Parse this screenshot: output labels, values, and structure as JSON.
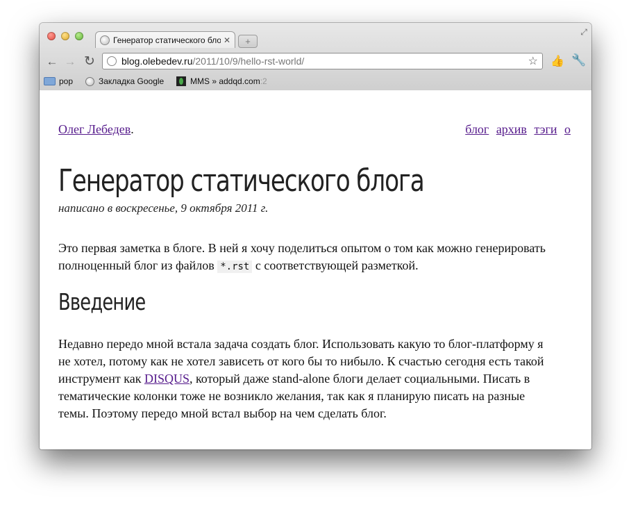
{
  "browser": {
    "tab_title": "Генератор статического бло",
    "tab_close": "✕",
    "new_tab": "+",
    "url_host": "blog.olebedev.ru",
    "url_path": "/2011/10/9/hello-rst-world/",
    "bookmarks": [
      {
        "label": "pop",
        "icon": "folder-icon"
      },
      {
        "label": "Закладка Google",
        "icon": "globe-icon"
      },
      {
        "label": "MMS » addqd.com",
        "suffix": ":2",
        "icon": "mms-icon"
      }
    ]
  },
  "site": {
    "author_link": "Олег Лебедев",
    "author_suffix": ".",
    "nav": [
      "блог",
      "архив",
      "тэги",
      "о"
    ]
  },
  "post": {
    "title": "Генератор статического блога",
    "date": "написано в воскресенье, 9 октября 2011 г.",
    "intro_before": "Это первая заметка в блоге. В ней я хочу поделиться опытом о том как можно генерировать полноценный блог из файлов ",
    "intro_code": "*.rst",
    "intro_after": " с соответствующей разметкой.",
    "section_title": "Введение",
    "body_before": "Недавно передо мной встала задача создать блог. Использовать какую то блог-платформу я не хотел, потому как не хотел зависеть от кого бы то нибыло. К счастью сегодня есть такой инструмент как ",
    "body_link": "DISQUS",
    "body_after": ", который даже stand-alone блоги делает социальными. Писать в тематические колонки тоже не возникло желания, так как я планирую писать на разные темы. Поэтому передо мной встал выбор на чем сделать блог."
  }
}
